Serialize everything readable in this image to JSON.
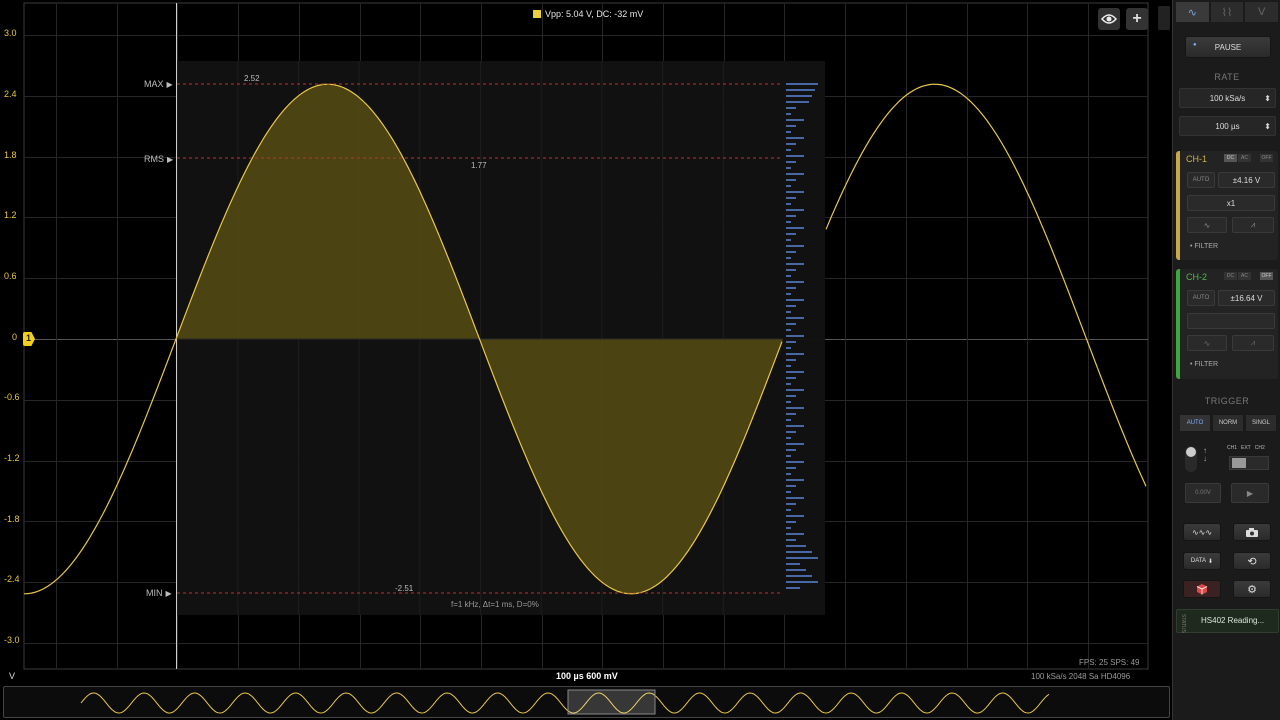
{
  "top_readout": {
    "text": "Vpp: 5.04 V, DC: -32 mV",
    "color": "#e8d040"
  },
  "y_axis": {
    "ticks": [
      "3.0",
      "2.4",
      "1.8",
      "1.2",
      "0.6",
      "0",
      "-0.6",
      "-1.2",
      "-1.8",
      "-2.4",
      "-3.0"
    ],
    "unit": "V",
    "color": "#e8c840"
  },
  "channel_marker": "1",
  "markers": {
    "max_label": "MAX",
    "rms_label": "RMS",
    "min_label": "MIN",
    "max_value": "2.52",
    "rms_value": "1.77",
    "min_value": "-2.51"
  },
  "analysis_text": "f=1 kHz, Δt=1 ms, D=0%",
  "scale_readout": "100 µs  600 mV",
  "fps_text": "FPS: 25  SPS: 49",
  "acquisition_text": "100 kSa/s    2048 Sa    HD4096",
  "icons": {
    "eye": "eye-icon",
    "plus": "plus-icon",
    "camera": "camera-icon",
    "gear": "gear-icon",
    "history": "history-icon"
  },
  "colors": {
    "trace": "#e8c84a",
    "fill": "#564c12",
    "marker_line": "#c0322a",
    "spectrum": "#5b86d6",
    "ch1": "#c8a84a",
    "ch2": "#3aa83a"
  },
  "panel": {
    "tabs": [
      "∿",
      "⌇⌇",
      "V"
    ],
    "pause_label": "PAUSE",
    "rate_title": "RATE",
    "rate_value": "100 kSa/s",
    "time_value": "100 µs",
    "ch1": {
      "label": "CH-1",
      "coupling": [
        "DC",
        "AC",
        "OFF"
      ],
      "auto_label": "AUTO",
      "range": "±4.16 V",
      "probe": "x1",
      "filter_label": "FILTER"
    },
    "ch2": {
      "label": "CH-2",
      "coupling": [
        "DC",
        "AC",
        "OFF"
      ],
      "auto_label": "AUTO",
      "range": "±16.64 V",
      "probe": "",
      "filter_label": "FILTER"
    },
    "trigger_title": "TRIGGER",
    "trigger_modes": [
      "AUTO",
      "NORM",
      "SINGL"
    ],
    "trigger_sources": [
      "CH1",
      "EXT",
      "CH2"
    ],
    "trigger_level": "0.00V",
    "data_label": "DATA",
    "status_label": "HS402 Reading...",
    "status_side": "STATUS"
  }
}
